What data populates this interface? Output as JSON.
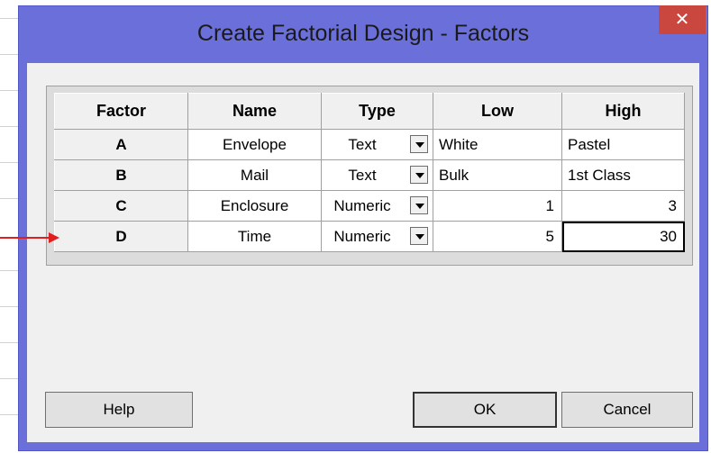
{
  "dialog": {
    "title": "Create Factorial Design - Factors",
    "close_glyph": "✕"
  },
  "grid": {
    "headers": [
      "Factor",
      "Name",
      "Type",
      "Low",
      "High"
    ],
    "rows": [
      {
        "factor": "A",
        "name": "Envelope",
        "type": "Text",
        "low": "White",
        "high": "Pastel"
      },
      {
        "factor": "B",
        "name": "Mail",
        "type": "Text",
        "low": "Bulk",
        "high": "1st Class"
      },
      {
        "factor": "C",
        "name": "Enclosure",
        "type": "Numeric",
        "low": "1",
        "high": "3"
      },
      {
        "factor": "D",
        "name": "Time",
        "type": "Numeric",
        "low": "5",
        "high": "30"
      }
    ]
  },
  "buttons": {
    "help": "Help",
    "ok": "OK",
    "cancel": "Cancel"
  },
  "annotation": {
    "arrow_color": "#e02020"
  }
}
